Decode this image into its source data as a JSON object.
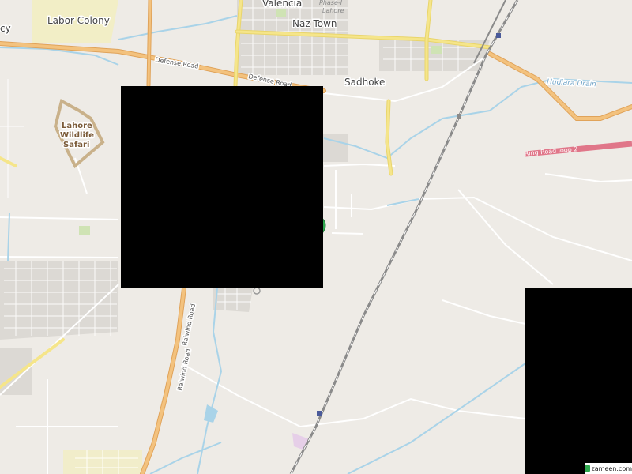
{
  "places": {
    "labor_colony": "Labor Colony",
    "valencia": "Valencia",
    "naz_town": "Naz Town",
    "sadhoke": "Sadhoke",
    "phase": "Phase-I",
    "lahore_small": "Lahore",
    "cy": "cy",
    "safari_line1": "Lahore",
    "safari_line2": "Wildlife",
    "safari_line3": "Safari"
  },
  "roads": {
    "defense_1": "Defense Road",
    "defense_2": "Defense Road",
    "raiwind_1": "Raiwind Road",
    "raiwind_2": "Raiwind Road",
    "ring_road": "Ring Road loop 2"
  },
  "water": {
    "hudiara_drain": "Hudiara Drain"
  },
  "marker": {
    "icon": "home-pin-icon",
    "color": "#2fa84f"
  },
  "attribution": {
    "text": "zameen.com"
  },
  "colors": {
    "land": "#eeebe6",
    "major_road": "#f3c27e",
    "major_road_edge": "#e0a35a",
    "yellow_road": "#f5e58a",
    "ring_road": "#e07689",
    "water": "#a9d3e8",
    "railway": "#8a8a8a",
    "built_up": "#d9d6d1"
  }
}
